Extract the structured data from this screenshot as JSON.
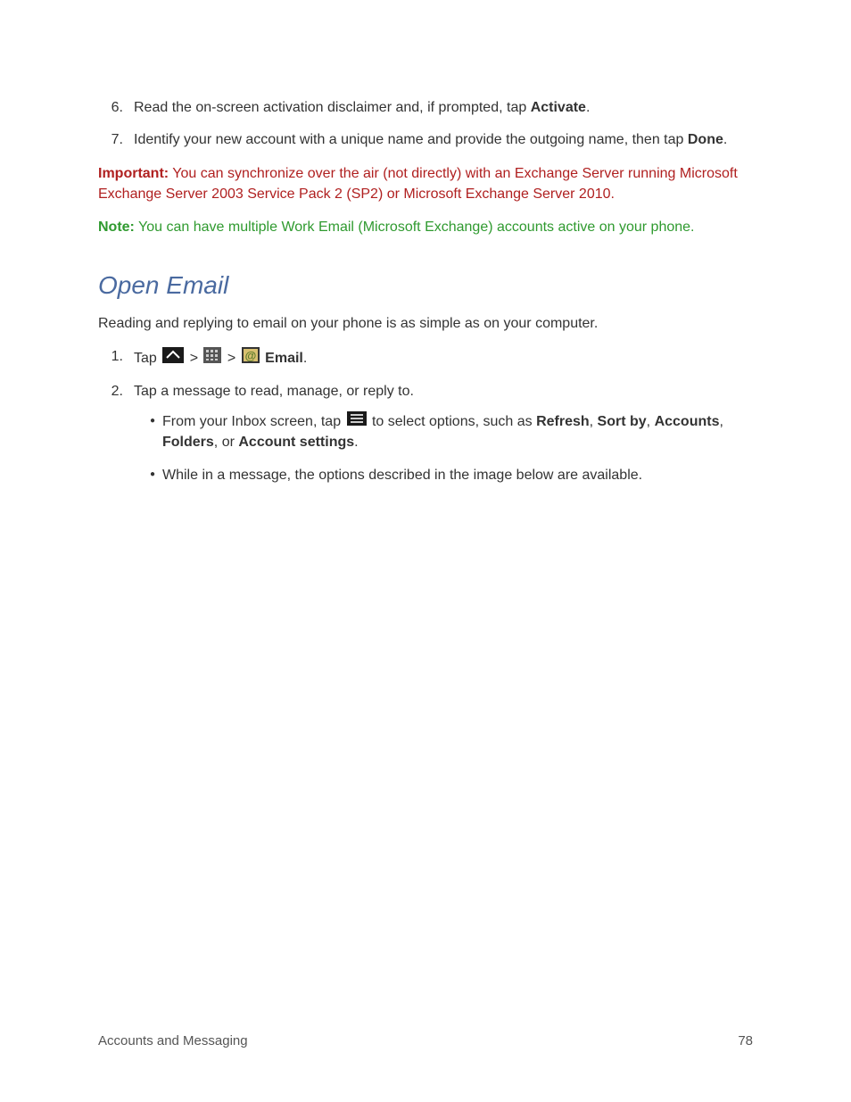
{
  "list1": {
    "item6": {
      "num": "6.",
      "text_a": "Read the on-screen activation disclaimer and, if prompted, tap ",
      "text_b": "Activate",
      "text_c": "."
    },
    "item7": {
      "num": "7.",
      "text_a": "Identify your new account with a unique name and provide the outgoing name, then tap ",
      "text_b": "Done",
      "text_c": "."
    }
  },
  "important": {
    "label": "Important:",
    "text": "  You can synchronize over the air (not directly) with an Exchange Server running Microsoft Exchange Server 2003 Service Pack 2 (SP2) or Microsoft Exchange Server 2010."
  },
  "note": {
    "label": "Note:",
    "text": "  You can have multiple Work Email (Microsoft Exchange) accounts active on your phone."
  },
  "heading": "Open Email",
  "intro": "Reading and replying to email on your phone is as simple as on your computer.",
  "list2": {
    "item1": {
      "num": "1.",
      "pre": "Tap ",
      "sep1": " > ",
      "sep2": " > ",
      "email_label": " Email",
      "period": "."
    },
    "item2": {
      "num": "2.",
      "text": "Tap a message to read, manage, or reply to.",
      "sub1": {
        "pre": "From your Inbox screen, tap ",
        "mid": " to select options, such as ",
        "opt1": "Refresh",
        "c1": ", ",
        "opt2": "Sort by",
        "c2": ", ",
        "opt3": "Accounts",
        "c3": ", ",
        "opt4": "Folders",
        "c4": ", or ",
        "opt5": "Account settings",
        "c5": "."
      },
      "sub2": "While in a message, the options described in the image below are available."
    }
  },
  "footer": {
    "left": "Accounts and Messaging",
    "right": "78"
  }
}
